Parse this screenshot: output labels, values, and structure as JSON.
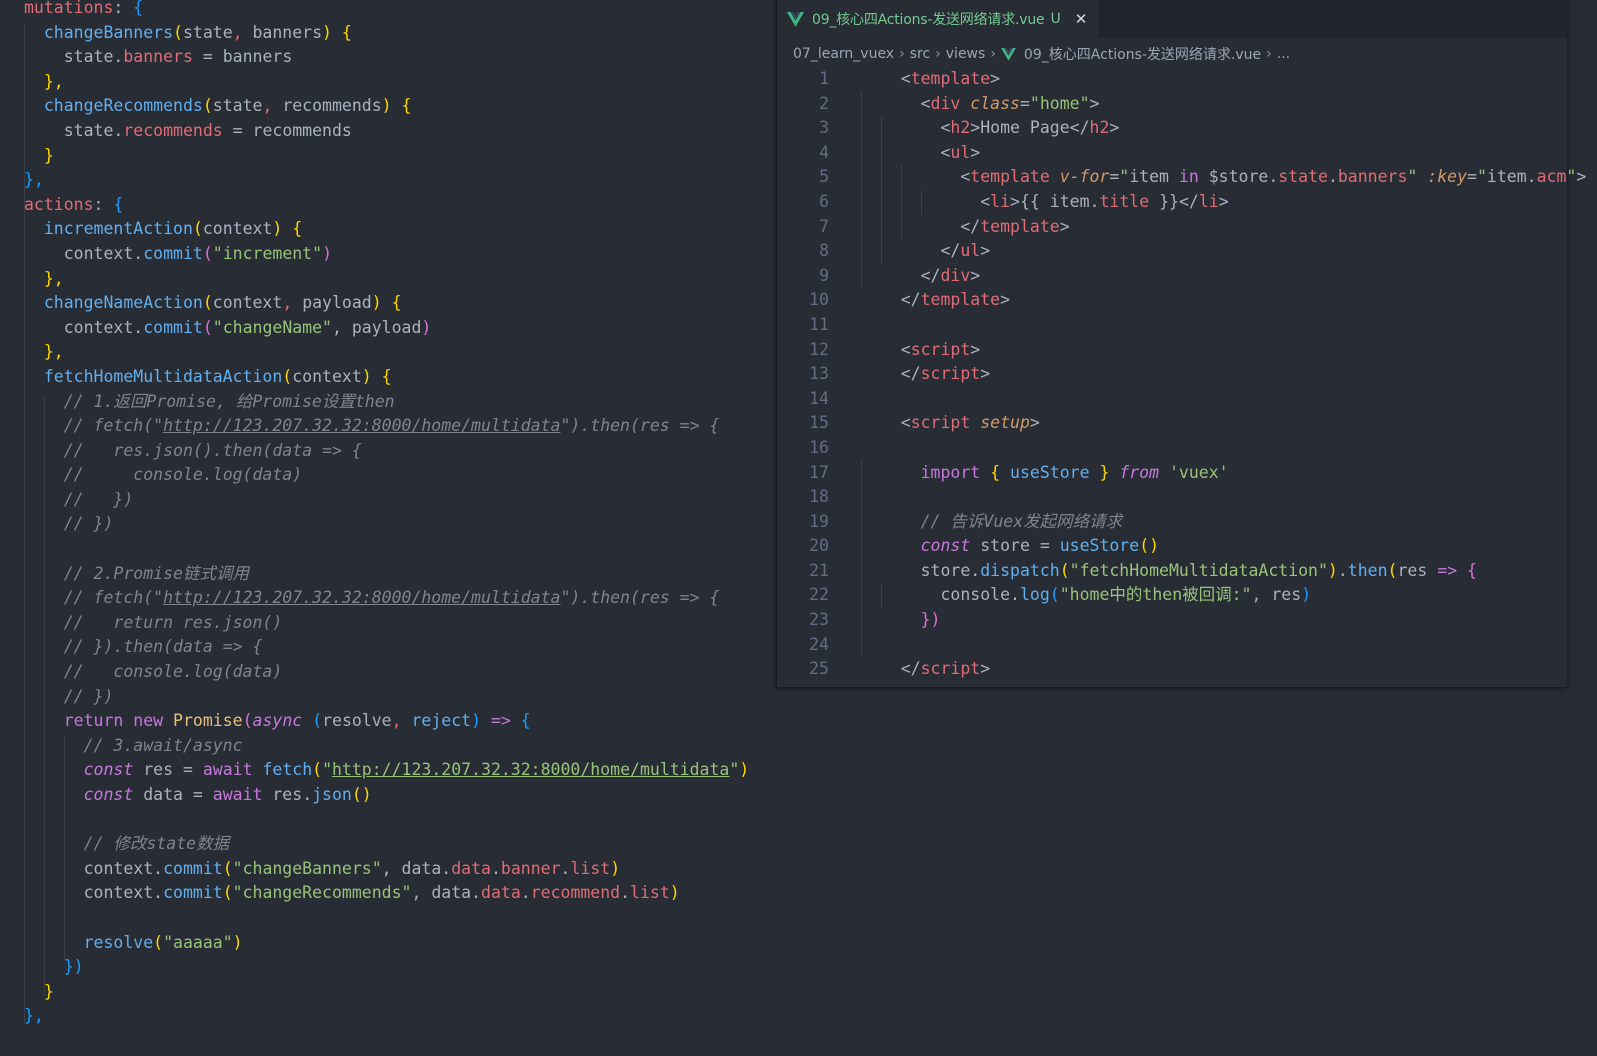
{
  "colors": {
    "editor_bg": "#282c34",
    "tabbar_bg": "#21252b",
    "tab_modified": "#73c991",
    "vue_green": "#41b883",
    "keyword": "#c678dd",
    "function": "#61afef",
    "property": "#e06c75",
    "string": "#98c379",
    "comment": "#7f848e",
    "bracket_1": "#ffd700",
    "bracket_2": "#da70d6",
    "bracket_3": "#179fff"
  },
  "right_editor": {
    "tab": {
      "icon": "vue-file-icon",
      "label": "09_核心四Actions-发送网络请求.vue",
      "status": "U",
      "close_icon": "close-icon"
    },
    "breadcrumb": [
      "07_learn_vuex",
      "src",
      "views",
      "09_核心四Actions-发送网络请求.vue",
      "..."
    ],
    "line_numbers": [
      "1",
      "2",
      "3",
      "4",
      "5",
      "6",
      "7",
      "8",
      "9",
      "10",
      "11",
      "12",
      "13",
      "14",
      "15",
      "16",
      "17",
      "18",
      "19",
      "20",
      "21",
      "22",
      "23",
      "24",
      "25"
    ],
    "lines": [
      [
        [
          "    ",
          "w"
        ],
        [
          "<",
          "w"
        ],
        [
          "template",
          "t"
        ],
        [
          ">",
          "w"
        ]
      ],
      [
        [
          "      ",
          "w"
        ],
        [
          "<",
          "w"
        ],
        [
          "div ",
          "t"
        ],
        [
          "class",
          "a"
        ],
        [
          "=",
          "w"
        ],
        [
          "\"home\"",
          "s"
        ],
        [
          ">",
          "w"
        ]
      ],
      [
        [
          "        ",
          "w"
        ],
        [
          "<",
          "w"
        ],
        [
          "h2",
          "t"
        ],
        [
          ">",
          "w"
        ],
        [
          "Home Page",
          "w"
        ],
        [
          "</",
          "w"
        ],
        [
          "h2",
          "t"
        ],
        [
          ">",
          "w"
        ]
      ],
      [
        [
          "        ",
          "w"
        ],
        [
          "<",
          "w"
        ],
        [
          "ul",
          "t"
        ],
        [
          ">",
          "w"
        ]
      ],
      [
        [
          "          ",
          "w"
        ],
        [
          "<",
          "w"
        ],
        [
          "template ",
          "t"
        ],
        [
          "v-for",
          "a"
        ],
        [
          "=",
          "w"
        ],
        [
          "\"",
          "s"
        ],
        [
          "item ",
          "w"
        ],
        [
          "in ",
          "k"
        ],
        [
          "$store",
          "w"
        ],
        [
          ".",
          "w"
        ],
        [
          "state",
          "p"
        ],
        [
          ".",
          "w"
        ],
        [
          "banners",
          "p"
        ],
        [
          "\" ",
          "s"
        ],
        [
          ":key",
          "a"
        ],
        [
          "=",
          "w"
        ],
        [
          "\"",
          "s"
        ],
        [
          "item",
          "w"
        ],
        [
          ".",
          "w"
        ],
        [
          "acm",
          "p"
        ],
        [
          "\"",
          "s"
        ],
        [
          ">",
          "w"
        ]
      ],
      [
        [
          "            ",
          "w"
        ],
        [
          "<",
          "w"
        ],
        [
          "li",
          "t"
        ],
        [
          ">",
          "w"
        ],
        [
          "{{ ",
          "w"
        ],
        [
          "item",
          "w"
        ],
        [
          ".",
          "w"
        ],
        [
          "title",
          "p"
        ],
        [
          " }}",
          "w"
        ],
        [
          "</",
          "w"
        ],
        [
          "li",
          "t"
        ],
        [
          ">",
          "w"
        ]
      ],
      [
        [
          "          ",
          "w"
        ],
        [
          "</",
          "w"
        ],
        [
          "template",
          "t"
        ],
        [
          ">",
          "w"
        ]
      ],
      [
        [
          "        ",
          "w"
        ],
        [
          "</",
          "w"
        ],
        [
          "ul",
          "t"
        ],
        [
          ">",
          "w"
        ]
      ],
      [
        [
          "      ",
          "w"
        ],
        [
          "</",
          "w"
        ],
        [
          "div",
          "t"
        ],
        [
          ">",
          "w"
        ]
      ],
      [
        [
          "    ",
          "w"
        ],
        [
          "</",
          "w"
        ],
        [
          "template",
          "t"
        ],
        [
          ">",
          "w"
        ]
      ],
      [
        [
          "",
          "w"
        ]
      ],
      [
        [
          "    ",
          "w"
        ],
        [
          "<",
          "w"
        ],
        [
          "script",
          "t"
        ],
        [
          ">",
          "w"
        ]
      ],
      [
        [
          "    ",
          "w"
        ],
        [
          "</",
          "w"
        ],
        [
          "script",
          "t"
        ],
        [
          ">",
          "w"
        ]
      ],
      [
        [
          "",
          "w"
        ]
      ],
      [
        [
          "    ",
          "w"
        ],
        [
          "<",
          "w"
        ],
        [
          "script ",
          "t"
        ],
        [
          "setup",
          "a"
        ],
        [
          ">",
          "w"
        ]
      ],
      [
        [
          "",
          "w"
        ]
      ],
      [
        [
          "      ",
          "w"
        ],
        [
          "import ",
          "k"
        ],
        [
          "{ ",
          "b1"
        ],
        [
          "useStore ",
          "f"
        ],
        [
          "} ",
          "b1"
        ],
        [
          "from ",
          "ki"
        ],
        [
          "'vuex'",
          "s"
        ]
      ],
      [
        [
          "",
          "w"
        ]
      ],
      [
        [
          "      ",
          "w"
        ],
        [
          "// 告诉Vuex发起网络请求",
          "c"
        ]
      ],
      [
        [
          "      ",
          "w"
        ],
        [
          "const ",
          "ki"
        ],
        [
          "store ",
          "w"
        ],
        [
          "= ",
          "w"
        ],
        [
          "useStore",
          "f"
        ],
        [
          "()",
          "b1"
        ]
      ],
      [
        [
          "      ",
          "w"
        ],
        [
          "store",
          "w"
        ],
        [
          ".",
          "w"
        ],
        [
          "dispatch",
          "f"
        ],
        [
          "(",
          "b1"
        ],
        [
          "\"fetchHomeMultidataAction\"",
          "s"
        ],
        [
          ")",
          "b1"
        ],
        [
          ".",
          "w"
        ],
        [
          "then",
          "f"
        ],
        [
          "(",
          "b1"
        ],
        [
          "res ",
          "w"
        ],
        [
          "=> ",
          "k"
        ],
        [
          "{",
          "b2"
        ]
      ],
      [
        [
          "        ",
          "w"
        ],
        [
          "console",
          "w"
        ],
        [
          ".",
          "w"
        ],
        [
          "log",
          "f"
        ],
        [
          "(",
          "b3"
        ],
        [
          "\"home中的then被回调:\"",
          "s"
        ],
        [
          ", ",
          "w"
        ],
        [
          "res",
          "w"
        ],
        [
          ")",
          "b3"
        ]
      ],
      [
        [
          "      ",
          "w"
        ],
        [
          "})",
          "b2"
        ]
      ],
      [
        [
          "",
          "w"
        ]
      ],
      [
        [
          "    ",
          "w"
        ],
        [
          "</",
          "w"
        ],
        [
          "script",
          "t"
        ],
        [
          ">",
          "w"
        ]
      ]
    ]
  },
  "left_editor": {
    "lines": [
      [
        [
          "mutations",
          "p"
        ],
        [
          ": ",
          "w"
        ],
        [
          "{",
          "b3"
        ]
      ],
      [
        [
          "  ",
          "w"
        ],
        [
          "changeBanners",
          "f"
        ],
        [
          "(",
          "b1"
        ],
        [
          "state",
          "par"
        ],
        [
          ", ",
          "p"
        ],
        [
          "banners",
          "par"
        ],
        [
          ") ",
          "b1"
        ],
        [
          "{",
          "b1"
        ]
      ],
      [
        [
          "    ",
          "w"
        ],
        [
          "state",
          "w"
        ],
        [
          ".",
          "w"
        ],
        [
          "banners ",
          "p"
        ],
        [
          "= ",
          "w"
        ],
        [
          "banners",
          "w"
        ]
      ],
      [
        [
          "  ",
          "w"
        ],
        [
          "},",
          "b1"
        ]
      ],
      [
        [
          "  ",
          "w"
        ],
        [
          "changeRecommends",
          "f"
        ],
        [
          "(",
          "b1"
        ],
        [
          "state",
          "par"
        ],
        [
          ", ",
          "p"
        ],
        [
          "recommends",
          "par"
        ],
        [
          ") ",
          "b1"
        ],
        [
          "{",
          "b1"
        ]
      ],
      [
        [
          "    ",
          "w"
        ],
        [
          "state",
          "w"
        ],
        [
          ".",
          "w"
        ],
        [
          "recommends ",
          "p"
        ],
        [
          "= ",
          "w"
        ],
        [
          "recommends",
          "w"
        ]
      ],
      [
        [
          "  ",
          "w"
        ],
        [
          "}",
          "b1"
        ]
      ],
      [
        [
          "},",
          "b3"
        ]
      ],
      [
        [
          "actions",
          "p"
        ],
        [
          ": ",
          "w"
        ],
        [
          "{",
          "b3"
        ]
      ],
      [
        [
          "  ",
          "w"
        ],
        [
          "incrementAction",
          "f"
        ],
        [
          "(",
          "b1"
        ],
        [
          "context",
          "par"
        ],
        [
          ") ",
          "b1"
        ],
        [
          "{",
          "b1"
        ]
      ],
      [
        [
          "    ",
          "w"
        ],
        [
          "context",
          "w"
        ],
        [
          ".",
          "w"
        ],
        [
          "commit",
          "f"
        ],
        [
          "(",
          "b2"
        ],
        [
          "\"increment\"",
          "s"
        ],
        [
          ")",
          "b2"
        ]
      ],
      [
        [
          "  ",
          "w"
        ],
        [
          "},",
          "b1"
        ]
      ],
      [
        [
          "  ",
          "w"
        ],
        [
          "changeNameAction",
          "f"
        ],
        [
          "(",
          "b1"
        ],
        [
          "context",
          "par"
        ],
        [
          ", ",
          "p"
        ],
        [
          "payload",
          "par"
        ],
        [
          ") ",
          "b1"
        ],
        [
          "{",
          "b1"
        ]
      ],
      [
        [
          "    ",
          "w"
        ],
        [
          "context",
          "w"
        ],
        [
          ".",
          "w"
        ],
        [
          "commit",
          "f"
        ],
        [
          "(",
          "b2"
        ],
        [
          "\"changeName\"",
          "s"
        ],
        [
          ", ",
          "w"
        ],
        [
          "payload",
          "w"
        ],
        [
          ")",
          "b2"
        ]
      ],
      [
        [
          "  ",
          "w"
        ],
        [
          "},",
          "b1"
        ]
      ],
      [
        [
          "  ",
          "w"
        ],
        [
          "fetchHomeMultidataAction",
          "f"
        ],
        [
          "(",
          "b1"
        ],
        [
          "context",
          "par"
        ],
        [
          ") ",
          "b1"
        ],
        [
          "{",
          "b1"
        ]
      ],
      [
        [
          "    ",
          "w"
        ],
        [
          "// 1.返回Promise, 给Promise设置then",
          "c"
        ]
      ],
      [
        [
          "    ",
          "w"
        ],
        [
          "// fetch(\"",
          "c"
        ],
        [
          "http://123.207.32.32:8000/home/multidata",
          "c u"
        ],
        [
          "\").then(res => {",
          "c"
        ]
      ],
      [
        [
          "    ",
          "w"
        ],
        [
          "//   res.json().then(data => {",
          "c"
        ]
      ],
      [
        [
          "    ",
          "w"
        ],
        [
          "//     console.log(data)",
          "c"
        ]
      ],
      [
        [
          "    ",
          "w"
        ],
        [
          "//   })",
          "c"
        ]
      ],
      [
        [
          "    ",
          "w"
        ],
        [
          "// })",
          "c"
        ]
      ],
      [
        [
          "",
          "w"
        ]
      ],
      [
        [
          "    ",
          "w"
        ],
        [
          "// 2.Promise链式调用",
          "c"
        ]
      ],
      [
        [
          "    ",
          "w"
        ],
        [
          "// fetch(\"",
          "c"
        ],
        [
          "http://123.207.32.32:8000/home/multidata",
          "c u"
        ],
        [
          "\").then(res => {",
          "c"
        ]
      ],
      [
        [
          "    ",
          "w"
        ],
        [
          "//   return res.json()",
          "c"
        ]
      ],
      [
        [
          "    ",
          "w"
        ],
        [
          "// }).then(data => {",
          "c"
        ]
      ],
      [
        [
          "    ",
          "w"
        ],
        [
          "//   console.log(data)",
          "c"
        ]
      ],
      [
        [
          "    ",
          "w"
        ],
        [
          "// })",
          "c"
        ]
      ],
      [
        [
          "    ",
          "w"
        ],
        [
          "return ",
          "k"
        ],
        [
          "new ",
          "k"
        ],
        [
          "Promise",
          "y"
        ],
        [
          "(",
          "b2"
        ],
        [
          "async ",
          "ki"
        ],
        [
          "(",
          "b3"
        ],
        [
          "resolve",
          "par"
        ],
        [
          ", ",
          "p"
        ],
        [
          "reject",
          "f"
        ],
        [
          ") ",
          "b3"
        ],
        [
          "=> ",
          "k"
        ],
        [
          "{",
          "b3"
        ]
      ],
      [
        [
          "      ",
          "w"
        ],
        [
          "// 3.await/async",
          "c"
        ]
      ],
      [
        [
          "      ",
          "w"
        ],
        [
          "const ",
          "ki"
        ],
        [
          "res ",
          "w"
        ],
        [
          "= ",
          "w"
        ],
        [
          "await ",
          "k"
        ],
        [
          "fetch",
          "f"
        ],
        [
          "(",
          "b1"
        ],
        [
          "\"",
          "s"
        ],
        [
          "http://123.207.32.32:8000/home/multidata",
          "s u"
        ],
        [
          "\"",
          "s"
        ],
        [
          ")",
          "b1"
        ]
      ],
      [
        [
          "      ",
          "w"
        ],
        [
          "const ",
          "ki"
        ],
        [
          "data ",
          "w"
        ],
        [
          "= ",
          "w"
        ],
        [
          "await ",
          "k"
        ],
        [
          "res",
          "w"
        ],
        [
          ".",
          "w"
        ],
        [
          "json",
          "f"
        ],
        [
          "()",
          "b1"
        ]
      ],
      [
        [
          "",
          "w"
        ]
      ],
      [
        [
          "      ",
          "w"
        ],
        [
          "// 修改state数据",
          "c"
        ]
      ],
      [
        [
          "      ",
          "w"
        ],
        [
          "context",
          "w"
        ],
        [
          ".",
          "w"
        ],
        [
          "commit",
          "f"
        ],
        [
          "(",
          "b1"
        ],
        [
          "\"changeBanners\"",
          "s"
        ],
        [
          ", ",
          "w"
        ],
        [
          "data",
          "w"
        ],
        [
          ".",
          "w"
        ],
        [
          "data",
          "p"
        ],
        [
          ".",
          "w"
        ],
        [
          "banner",
          "p"
        ],
        [
          ".",
          "w"
        ],
        [
          "list",
          "p"
        ],
        [
          ")",
          "b1"
        ]
      ],
      [
        [
          "      ",
          "w"
        ],
        [
          "context",
          "w"
        ],
        [
          ".",
          "w"
        ],
        [
          "commit",
          "f"
        ],
        [
          "(",
          "b1"
        ],
        [
          "\"changeRecommends\"",
          "s"
        ],
        [
          ", ",
          "w"
        ],
        [
          "data",
          "w"
        ],
        [
          ".",
          "w"
        ],
        [
          "data",
          "p"
        ],
        [
          ".",
          "w"
        ],
        [
          "recommend",
          "p"
        ],
        [
          ".",
          "w"
        ],
        [
          "list",
          "p"
        ],
        [
          ")",
          "b1"
        ]
      ],
      [
        [
          "",
          "w"
        ]
      ],
      [
        [
          "      ",
          "w"
        ],
        [
          "resolve",
          "f"
        ],
        [
          "(",
          "b1"
        ],
        [
          "\"aaaaa\"",
          "s"
        ],
        [
          ")",
          "b1"
        ]
      ],
      [
        [
          "    ",
          "w"
        ],
        [
          "})",
          "b3"
        ]
      ],
      [
        [
          "  ",
          "w"
        ],
        [
          "}",
          "b1"
        ]
      ],
      [
        [
          "},",
          "b3"
        ]
      ],
      [
        [
          "",
          "w"
        ]
      ]
    ]
  }
}
